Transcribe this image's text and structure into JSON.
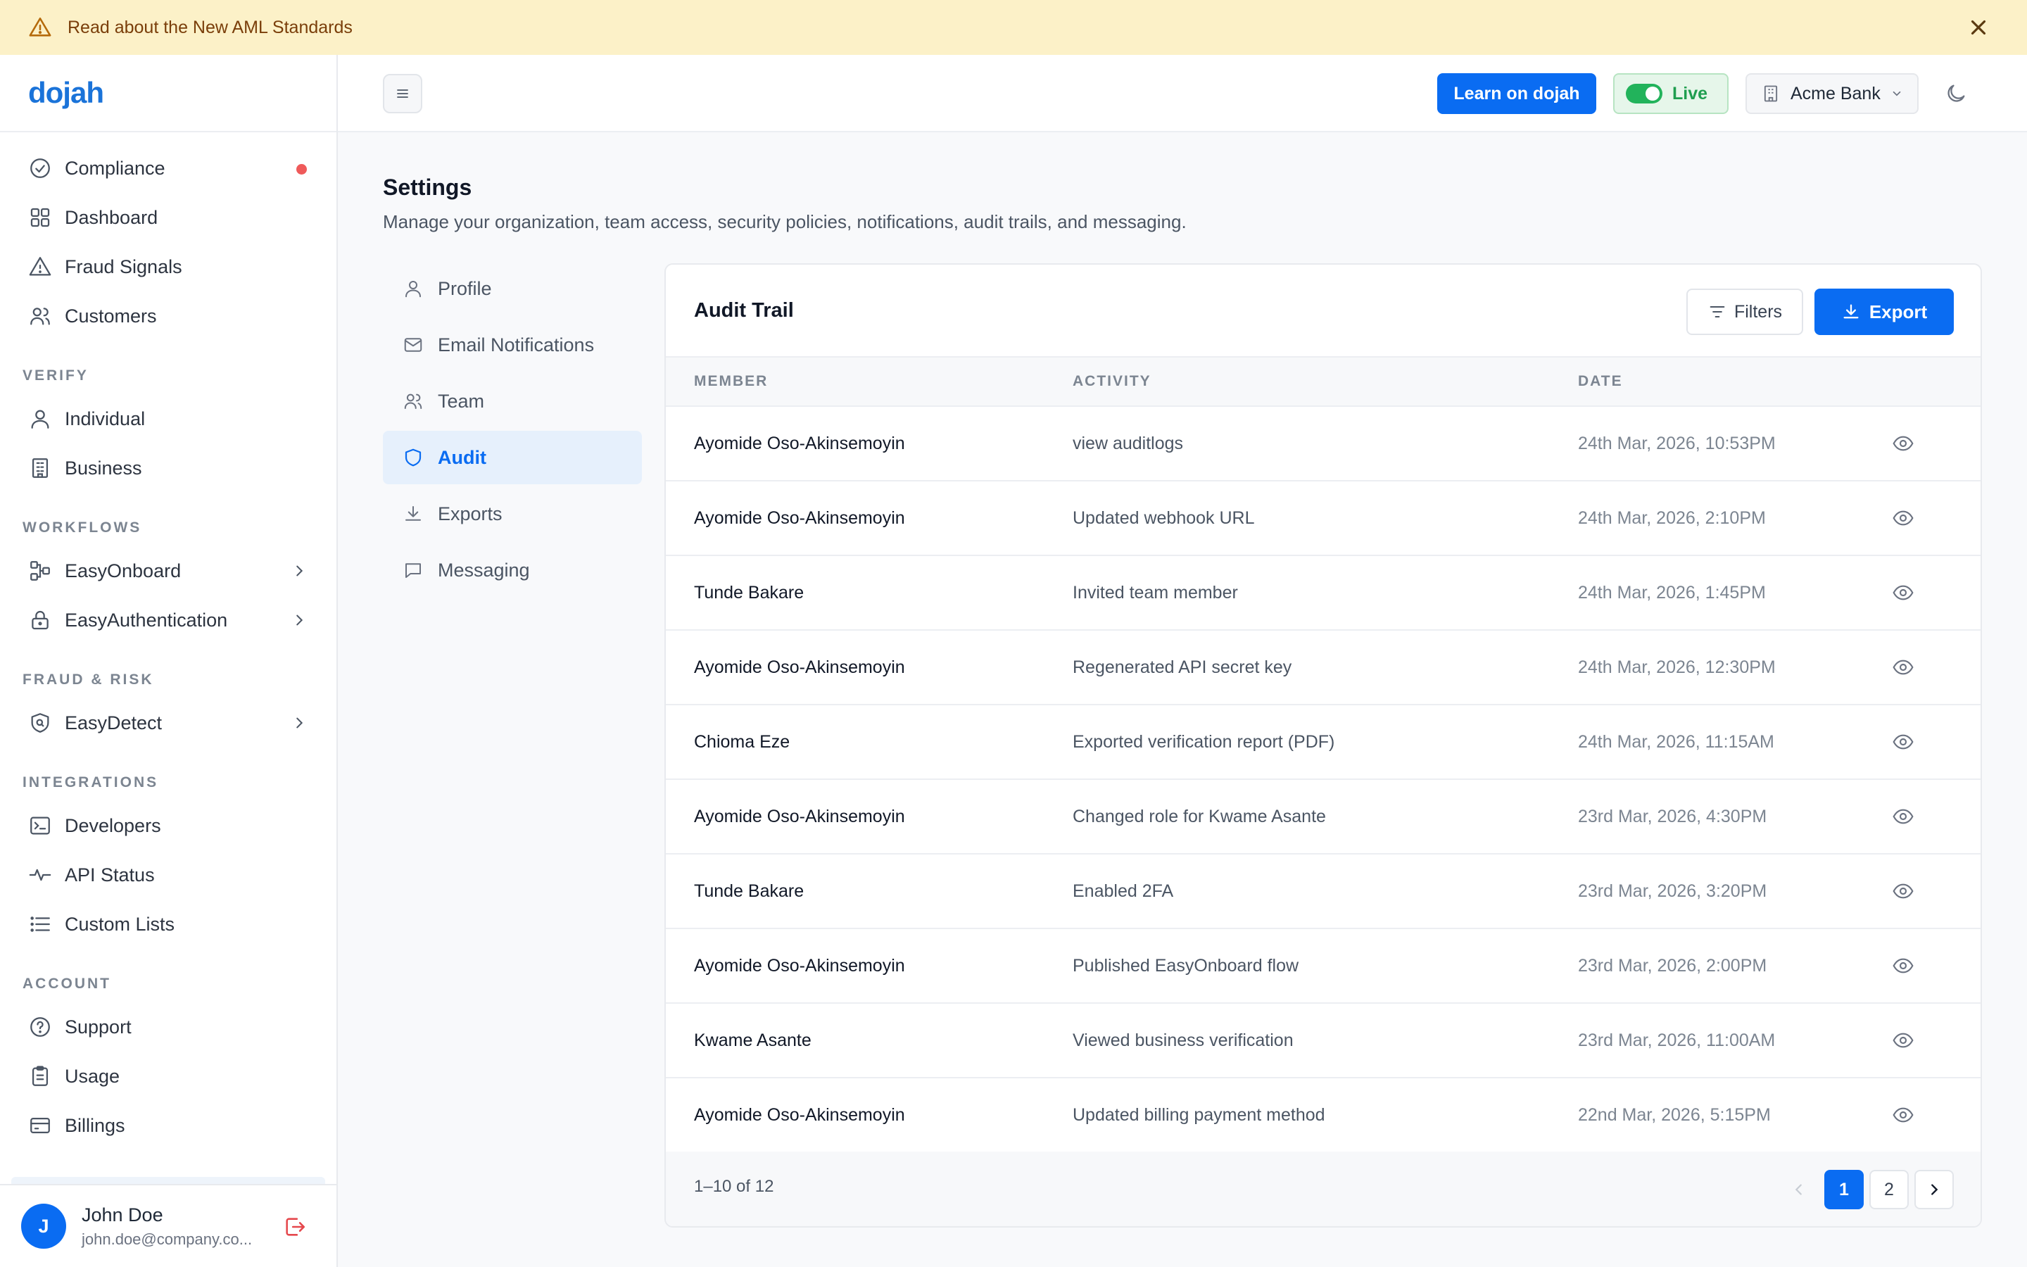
{
  "banner": {
    "text": "Read about the New AML Standards"
  },
  "brand": {
    "logo_text": "dojah",
    "accent": "#0a6cf2"
  },
  "sidebar": {
    "top_items": [
      {
        "label": "Compliance",
        "icon": "check-circle-icon",
        "alert": true
      },
      {
        "label": "Dashboard",
        "icon": "grid-icon"
      },
      {
        "label": "Fraud Signals",
        "icon": "warning-icon"
      },
      {
        "label": "Customers",
        "icon": "users-icon"
      }
    ],
    "sections": {
      "verify": "VERIFY",
      "workflows": "WORKFLOWS",
      "fraud_risk": "FRAUD & RISK",
      "integrations": "INTEGRATIONS",
      "account": "ACCOUNT"
    },
    "verify_items": [
      {
        "label": "Individual",
        "icon": "user-icon"
      },
      {
        "label": "Business",
        "icon": "building-icon"
      }
    ],
    "workflow_items": [
      {
        "label": "EasyOnboard",
        "icon": "workflow-icon"
      },
      {
        "label": "EasyAuthentication",
        "icon": "lock-icon"
      }
    ],
    "fraud_items": [
      {
        "label": "EasyDetect",
        "icon": "shield-scan-icon"
      }
    ],
    "integration_items": [
      {
        "label": "Developers",
        "icon": "terminal-icon"
      },
      {
        "label": "API Status",
        "icon": "pulse-icon"
      },
      {
        "label": "Custom Lists",
        "icon": "list-icon"
      }
    ],
    "account_items": [
      {
        "label": "Support",
        "icon": "help-icon"
      },
      {
        "label": "Usage",
        "icon": "clipboard-icon"
      },
      {
        "label": "Billings",
        "icon": "card-icon"
      }
    ],
    "user": {
      "initial": "J",
      "name": "John Doe",
      "email": "john.doe@company.co..."
    }
  },
  "topbar": {
    "learn_label": "Learn on dojah",
    "live_label": "Live",
    "org_label": "Acme Bank"
  },
  "settings": {
    "title": "Settings",
    "subtitle": "Manage your organization, team access, security policies, notifications, audit trails, and messaging.",
    "nav": [
      {
        "label": "Profile",
        "icon": "user-icon"
      },
      {
        "label": "Email Notifications",
        "icon": "mail-icon"
      },
      {
        "label": "Team",
        "icon": "users-icon"
      },
      {
        "label": "Audit",
        "icon": "shield-icon",
        "active": true
      },
      {
        "label": "Exports",
        "icon": "download-icon"
      },
      {
        "label": "Messaging",
        "icon": "chat-icon"
      }
    ]
  },
  "audit": {
    "title": "Audit Trail",
    "filters_label": "Filters",
    "export_label": "Export",
    "columns": [
      "MEMBER",
      "ACTIVITY",
      "DATE"
    ],
    "rows": [
      {
        "member": "Ayomide Oso-Akinsemoyin",
        "activity": "view auditlogs",
        "date": "24th Mar, 2026, 10:53PM"
      },
      {
        "member": "Ayomide Oso-Akinsemoyin",
        "activity": "Updated webhook URL",
        "date": "24th Mar, 2026, 2:10PM"
      },
      {
        "member": "Tunde Bakare",
        "activity": "Invited team member",
        "date": "24th Mar, 2026, 1:45PM"
      },
      {
        "member": "Ayomide Oso-Akinsemoyin",
        "activity": "Regenerated API secret key",
        "date": "24th Mar, 2026, 12:30PM"
      },
      {
        "member": "Chioma Eze",
        "activity": "Exported verification report (PDF)",
        "date": "24th Mar, 2026, 11:15AM"
      },
      {
        "member": "Ayomide Oso-Akinsemoyin",
        "activity": "Changed role for Kwame Asante",
        "date": "23rd Mar, 2026, 4:30PM"
      },
      {
        "member": "Tunde Bakare",
        "activity": "Enabled 2FA",
        "date": "23rd Mar, 2026, 3:20PM"
      },
      {
        "member": "Ayomide Oso-Akinsemoyin",
        "activity": "Published EasyOnboard flow",
        "date": "23rd Mar, 2026, 2:00PM"
      },
      {
        "member": "Kwame Asante",
        "activity": "Viewed business verification",
        "date": "23rd Mar, 2026, 11:00AM"
      },
      {
        "member": "Ayomide Oso-Akinsemoyin",
        "activity": "Updated billing payment method",
        "date": "22nd Mar, 2026, 5:15PM"
      }
    ],
    "pagination": {
      "summary": "1–10 of 12",
      "page1": "1",
      "page2": "2"
    }
  }
}
